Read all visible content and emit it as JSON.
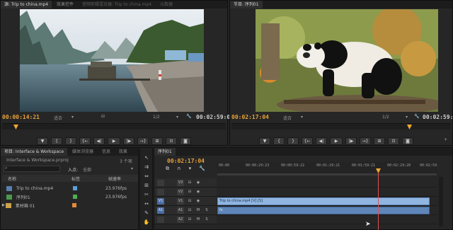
{
  "source_panel": {
    "tabs": [
      "源: Trip to china.mp4",
      "效果控件",
      "音频剪辑混合器: Trip to china.mp4",
      "元数据"
    ],
    "timecode_in": "00:00:14:21",
    "fit": "适合",
    "ratio": "1/2",
    "duration": "00:02:59:02"
  },
  "program_panel": {
    "tab": "节目: 序列01",
    "timecode_in": "00:02:17:04",
    "fit": "适合",
    "ratio": "1/2",
    "duration": "00:02:59:02"
  },
  "transport_icons": [
    "{",
    "}",
    "{←",
    "◀",
    "▶",
    "▶|",
    "→}",
    "⊞",
    "⊡",
    "📷"
  ],
  "project_panel": {
    "tabs": [
      "项目: Interface & Workspace",
      "媒体浏览器",
      "信息",
      "效果"
    ],
    "project_file": "Interface & Workspace.prproj",
    "item_count": "3 个项",
    "in_label": "入点:",
    "in_value": "全部",
    "columns": [
      "名称",
      "标签",
      "帧速率"
    ],
    "items": [
      {
        "name": "Trip to china.mp4",
        "color": "#5aa0d8",
        "fps": "23.976fps"
      },
      {
        "name": "序列01",
        "color": "#4caf50",
        "fps": "23.976fps"
      },
      {
        "name": "素材箱 01",
        "color": "#e08a3a",
        "fps": ""
      }
    ]
  },
  "timeline": {
    "tab": "序列01",
    "timecode": "00:02:17:04",
    "ruler_labels": [
      "00:00",
      "00:00:29:23",
      "00:00:59:22",
      "00:01:29:21",
      "00:01:59:21",
      "00:02:29:20",
      "00:02:59"
    ],
    "tracks": [
      {
        "id": "V3",
        "clip": ""
      },
      {
        "id": "V2",
        "clip": ""
      },
      {
        "id": "V1",
        "clip": "Trip to china.mp4 [V] [S]"
      },
      {
        "id": "A1",
        "clip": ""
      },
      {
        "id": "A2",
        "clip": ""
      }
    ],
    "tools": [
      "↖",
      "⇉",
      "⇔",
      "✂",
      "⊟",
      "↔",
      "✎",
      "✋",
      "🔍"
    ]
  },
  "colors": {
    "accent_orange": "#e8a23a",
    "clip_video": "#8fb5e0",
    "clip_audio": "#5f86b8",
    "playhead": "#e05050"
  }
}
